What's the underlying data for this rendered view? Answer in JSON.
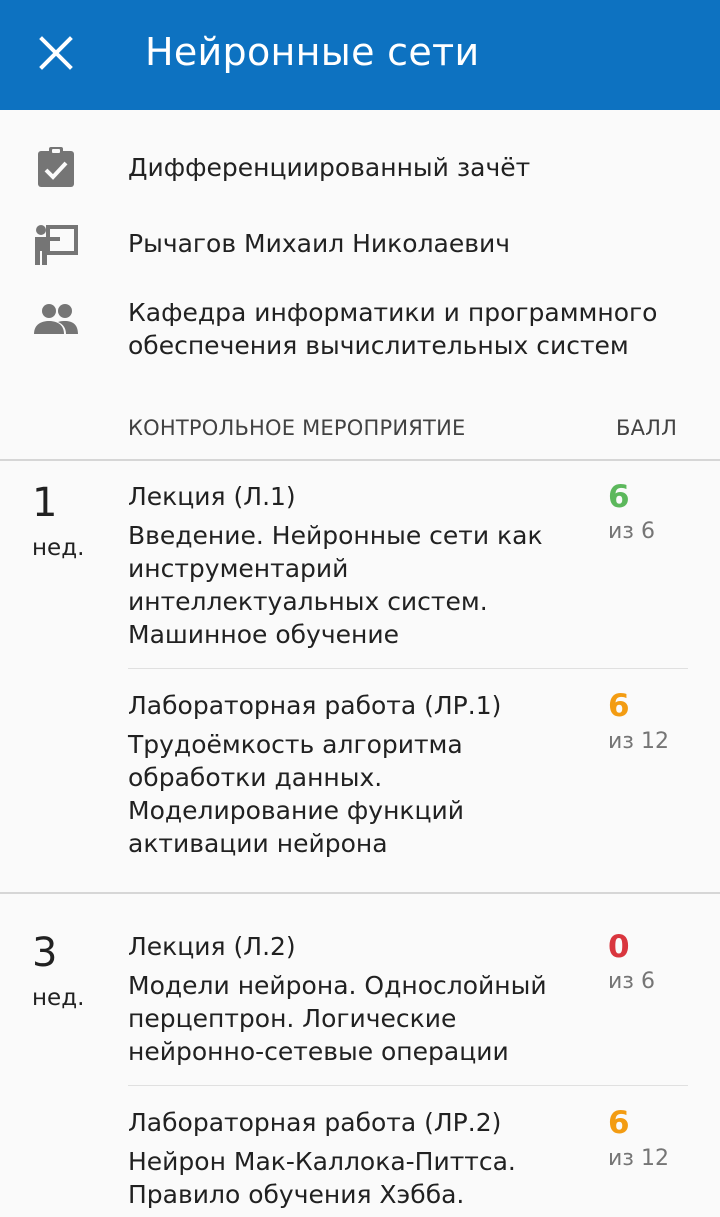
{
  "appbar": {
    "title": "Нейронные сети",
    "close_icon": "close-icon"
  },
  "info": {
    "exam_type": "Дифференциированный зачёт",
    "teacher": "Рычагов Михаил Николаевич",
    "department": "Кафедра информатики и программного обеспечения вычислительных систем"
  },
  "table": {
    "col_event": "КОНТРОЛЬНОЕ МЕРОПРИЯТИЕ",
    "col_score": "БАЛЛ"
  },
  "colors": {
    "appbar": "#0d72c1",
    "full": "#5cb85c",
    "partial": "#f39c12",
    "zero": "#d9363e"
  },
  "weeks": [
    {
      "number": "1",
      "label": "нед.",
      "events": [
        {
          "type": "Лекция (Л.1)",
          "topic": "Введение. Нейронные сети как инструментарий интеллектуальных систем. Машинное обучение",
          "score": "6",
          "max": "из 6"
        },
        {
          "type": "Лабораторная работа (ЛР.1)",
          "topic": "Трудоёмкость алгоритма обработки данных. Моделирование функций активации нейрона",
          "score": "6",
          "max": "из 12"
        }
      ]
    },
    {
      "number": "3",
      "label": "нед.",
      "events": [
        {
          "type": "Лекция (Л.2)",
          "topic": "Модели нейрона. Однослойный перцептрон. Логические нейронно-сетевые операции",
          "score": "0",
          "max": "из 6"
        },
        {
          "type": "Лабораторная работа (ЛР.2)",
          "topic": "Нейрон Мак-Каллока-Питтса. Правило обучения Хэбба.",
          "score": "6",
          "max": "из 12"
        }
      ]
    }
  ]
}
